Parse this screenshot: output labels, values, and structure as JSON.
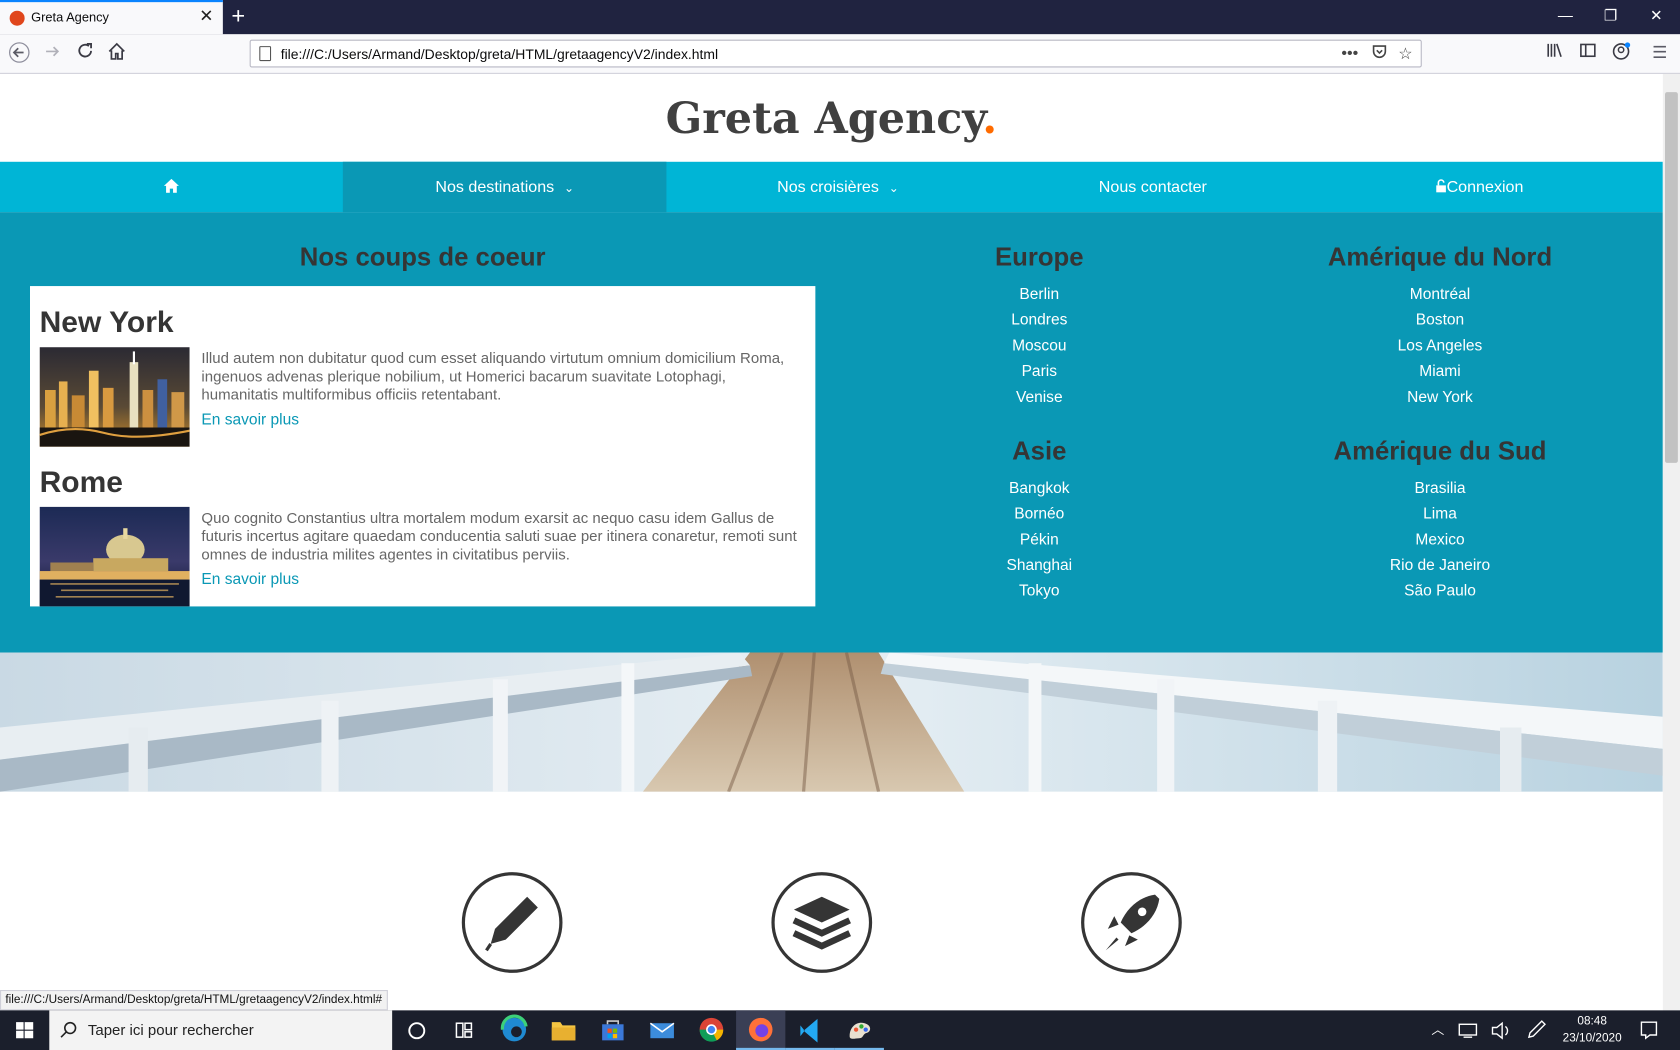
{
  "browser": {
    "tab_title": "Greta Agency",
    "url": "file:///C:/Users/Armand/Desktop/greta/HTML/gretaagencyV2/index.html",
    "status_url": "file:///C:/Users/Armand/Desktop/greta/HTML/gretaagencyV2/index.html#"
  },
  "site": {
    "logo_text": "Greta Agency",
    "logo_dot": ".",
    "accent_color": "#00b5d6",
    "dark_accent_color": "#0a98b5",
    "logo_dot_color": "#ff6b00",
    "menu": {
      "destinations": "Nos destinations",
      "croisieres": "Nos croisières",
      "contact": "Nous contacter",
      "login": "Connexion"
    },
    "coups": {
      "title": "Nos coups de coeur",
      "items": [
        {
          "title": "New York",
          "text": "Illud autem non dubitatur quod cum esset aliquando virtutum omnium domicilium Roma, ingenuos advenas plerique nobilium, ut Homerici bacarum suavitate Lotophagi, humanitatis multiformibus officiis retentabant.",
          "link": "En savoir plus"
        },
        {
          "title": "Rome",
          "text": "Quo cognito Constantius ultra mortalem modum exarsit ac nequo casu idem Gallus de futuris incertus agitare quaedam conducentia saluti suae per itinera conaretur, remoti sunt omnes de industria milites agentes in civitatibus perviis.",
          "link": "En savoir plus"
        }
      ]
    },
    "regions": [
      {
        "title": "Europe",
        "cities": [
          "Berlin",
          "Londres",
          "Moscou",
          "Paris",
          "Venise"
        ]
      },
      {
        "title": "Amérique du Nord",
        "cities": [
          "Montréal",
          "Boston",
          "Los Angeles",
          "Miami",
          "New York"
        ]
      },
      {
        "title": "Asie",
        "cities": [
          "Bangkok",
          "Bornéo",
          "Pékin",
          "Shanghai",
          "Tokyo"
        ]
      },
      {
        "title": "Amérique du Sud",
        "cities": [
          "Brasilia",
          "Lima",
          "Mexico",
          "Rio de Janeiro",
          "São Paulo"
        ]
      }
    ]
  },
  "taskbar": {
    "search_placeholder": "Taper ici pour rechercher",
    "time": "08:48",
    "date": "23/10/2020"
  }
}
